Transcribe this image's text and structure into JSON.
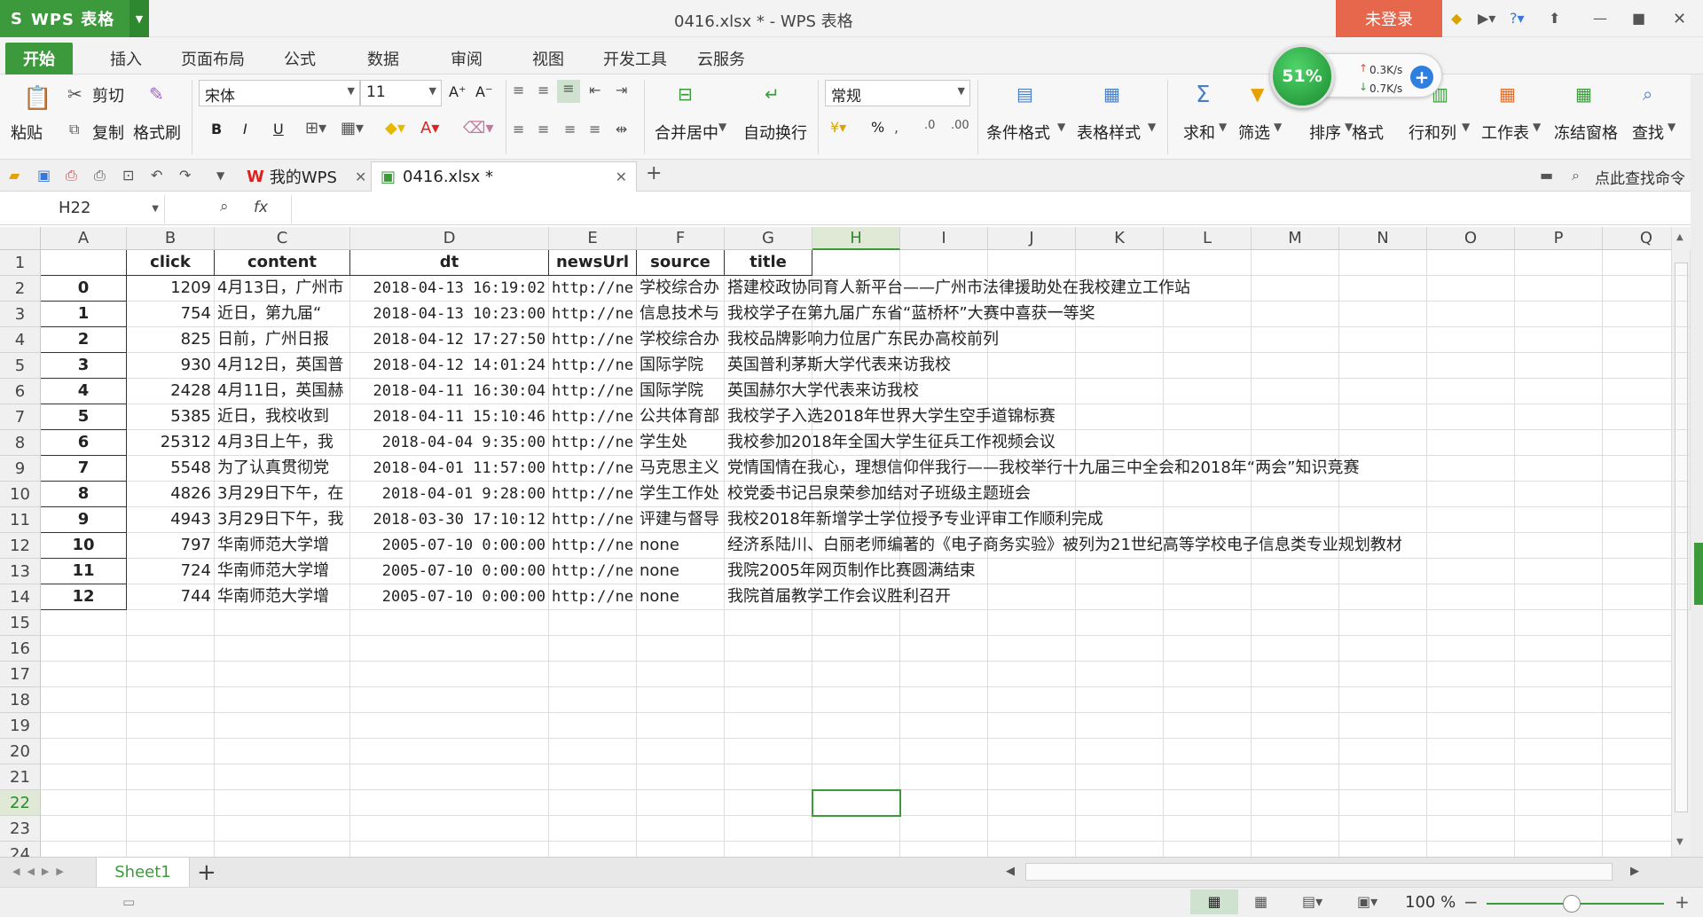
{
  "titlebar": {
    "app_s": "S",
    "app_name": "WPS 表格",
    "window_title": "0416.xlsx * - WPS 表格",
    "login": "未登录"
  },
  "menu": [
    "开始",
    "插入",
    "页面布局",
    "公式",
    "数据",
    "审阅",
    "视图",
    "开发工具",
    "云服务"
  ],
  "ribbon": {
    "paste": "粘贴",
    "cut": "剪切",
    "copy": "复制",
    "format_painter": "格式刷",
    "font_name": "宋体",
    "font_size": "11",
    "merge_center": "合并居中",
    "wrap_text": "自动换行",
    "number_format": "常规",
    "cond_format": "条件格式",
    "table_style": "表格样式",
    "sum": "求和",
    "filter": "筛选",
    "sort": "排序",
    "format": "格式",
    "rowcol": "行和列",
    "worksheet": "工作表",
    "freeze": "冻结窗格",
    "find": "查找",
    "bold": "B",
    "italic": "I",
    "underline": "U",
    "percent": "%"
  },
  "speed": {
    "percent": "51%",
    "up": "0.3K/s",
    "down": "0.7K/s"
  },
  "tabs": {
    "home": "我的WPS",
    "file": "0416.xlsx *",
    "search": "点此查找命令"
  },
  "formula": {
    "namebox": "H22",
    "fx": "fx",
    "value": ""
  },
  "columns": [
    "A",
    "B",
    "C",
    "D",
    "E",
    "F",
    "G",
    "H",
    "I",
    "J",
    "K",
    "L",
    "M",
    "N",
    "O",
    "P",
    "Q"
  ],
  "rows": [
    "1",
    "2",
    "3",
    "4",
    "5",
    "6",
    "7",
    "8",
    "9",
    "10",
    "11",
    "12",
    "13",
    "14",
    "15",
    "16",
    "17",
    "18",
    "19",
    "20",
    "21",
    "22",
    "23",
    "24"
  ],
  "headers": [
    "",
    "click",
    "content",
    "dt",
    "newsUrl",
    "source",
    "title"
  ],
  "data": [
    [
      "0",
      "1209",
      "4月13日，广州市",
      "2018-04-13 16:19:02",
      "http://ne",
      "学校综合办",
      "搭建校政协同育人新平台——广州市法律援助处在我校建立工作站"
    ],
    [
      "1",
      "754",
      "近日，第九届“",
      "2018-04-13 10:23:00",
      "http://ne",
      "信息技术与",
      "我校学子在第九届广东省“蓝桥杯”大赛中喜获一等奖"
    ],
    [
      "2",
      "825",
      "日前，广州日报",
      "2018-04-12 17:27:50",
      "http://ne",
      "学校综合办",
      "我校品牌影响力位居广东民办高校前列"
    ],
    [
      "3",
      "930",
      "4月12日，英国普",
      "2018-04-12 14:01:24",
      "http://ne",
      "国际学院",
      "英国普利茅斯大学代表来访我校"
    ],
    [
      "4",
      "2428",
      "4月11日，英国赫",
      "2018-04-11 16:30:04",
      "http://ne",
      "国际学院",
      "英国赫尔大学代表来访我校"
    ],
    [
      "5",
      "5385",
      "近日，我校收到",
      "2018-04-11 15:10:46",
      "http://ne",
      "公共体育部",
      "我校学子入选2018年世界大学生空手道锦标赛"
    ],
    [
      "6",
      "25312",
      "4月3日上午，我",
      "2018-04-04 9:35:00",
      "http://ne",
      "学生处",
      "我校参加2018年全国大学生征兵工作视频会议"
    ],
    [
      "7",
      "5548",
      "为了认真贯彻党",
      "2018-04-01 11:57:00",
      "http://ne",
      "马克思主义",
      "党情国情在我心，理想信仰伴我行——我校举行十九届三中全会和2018年“两会”知识竞赛"
    ],
    [
      "8",
      "4826",
      "3月29日下午，在",
      "2018-04-01 9:28:00",
      "http://ne",
      "学生工作处",
      "校党委书记吕泉荣参加结对子班级主题班会"
    ],
    [
      "9",
      "4943",
      "3月29日下午，我",
      "2018-03-30 17:10:12",
      "http://ne",
      "评建与督导",
      "我校2018年新增学士学位授予专业评审工作顺利完成"
    ],
    [
      "10",
      "797",
      "华南师范大学增",
      "2005-07-10 0:00:00",
      "http://ne",
      "none",
      "经济系陆川、白丽老师编著的《电子商务实验》被列为21世纪高等学校电子信息类专业规划教材"
    ],
    [
      "11",
      "724",
      "华南师范大学增",
      "2005-07-10 0:00:00",
      "http://ne",
      "none",
      "我院2005年网页制作比赛圆满结束"
    ],
    [
      "12",
      "744",
      "华南师范大学增",
      "2005-07-10 0:00:00",
      "http://ne",
      "none",
      "我院首届教学工作会议胜利召开"
    ]
  ],
  "sheet": {
    "name": "Sheet1"
  },
  "status": {
    "zoom": "100 %"
  },
  "colors": {
    "accent": "#3c9a3c",
    "login": "#e7674d"
  }
}
